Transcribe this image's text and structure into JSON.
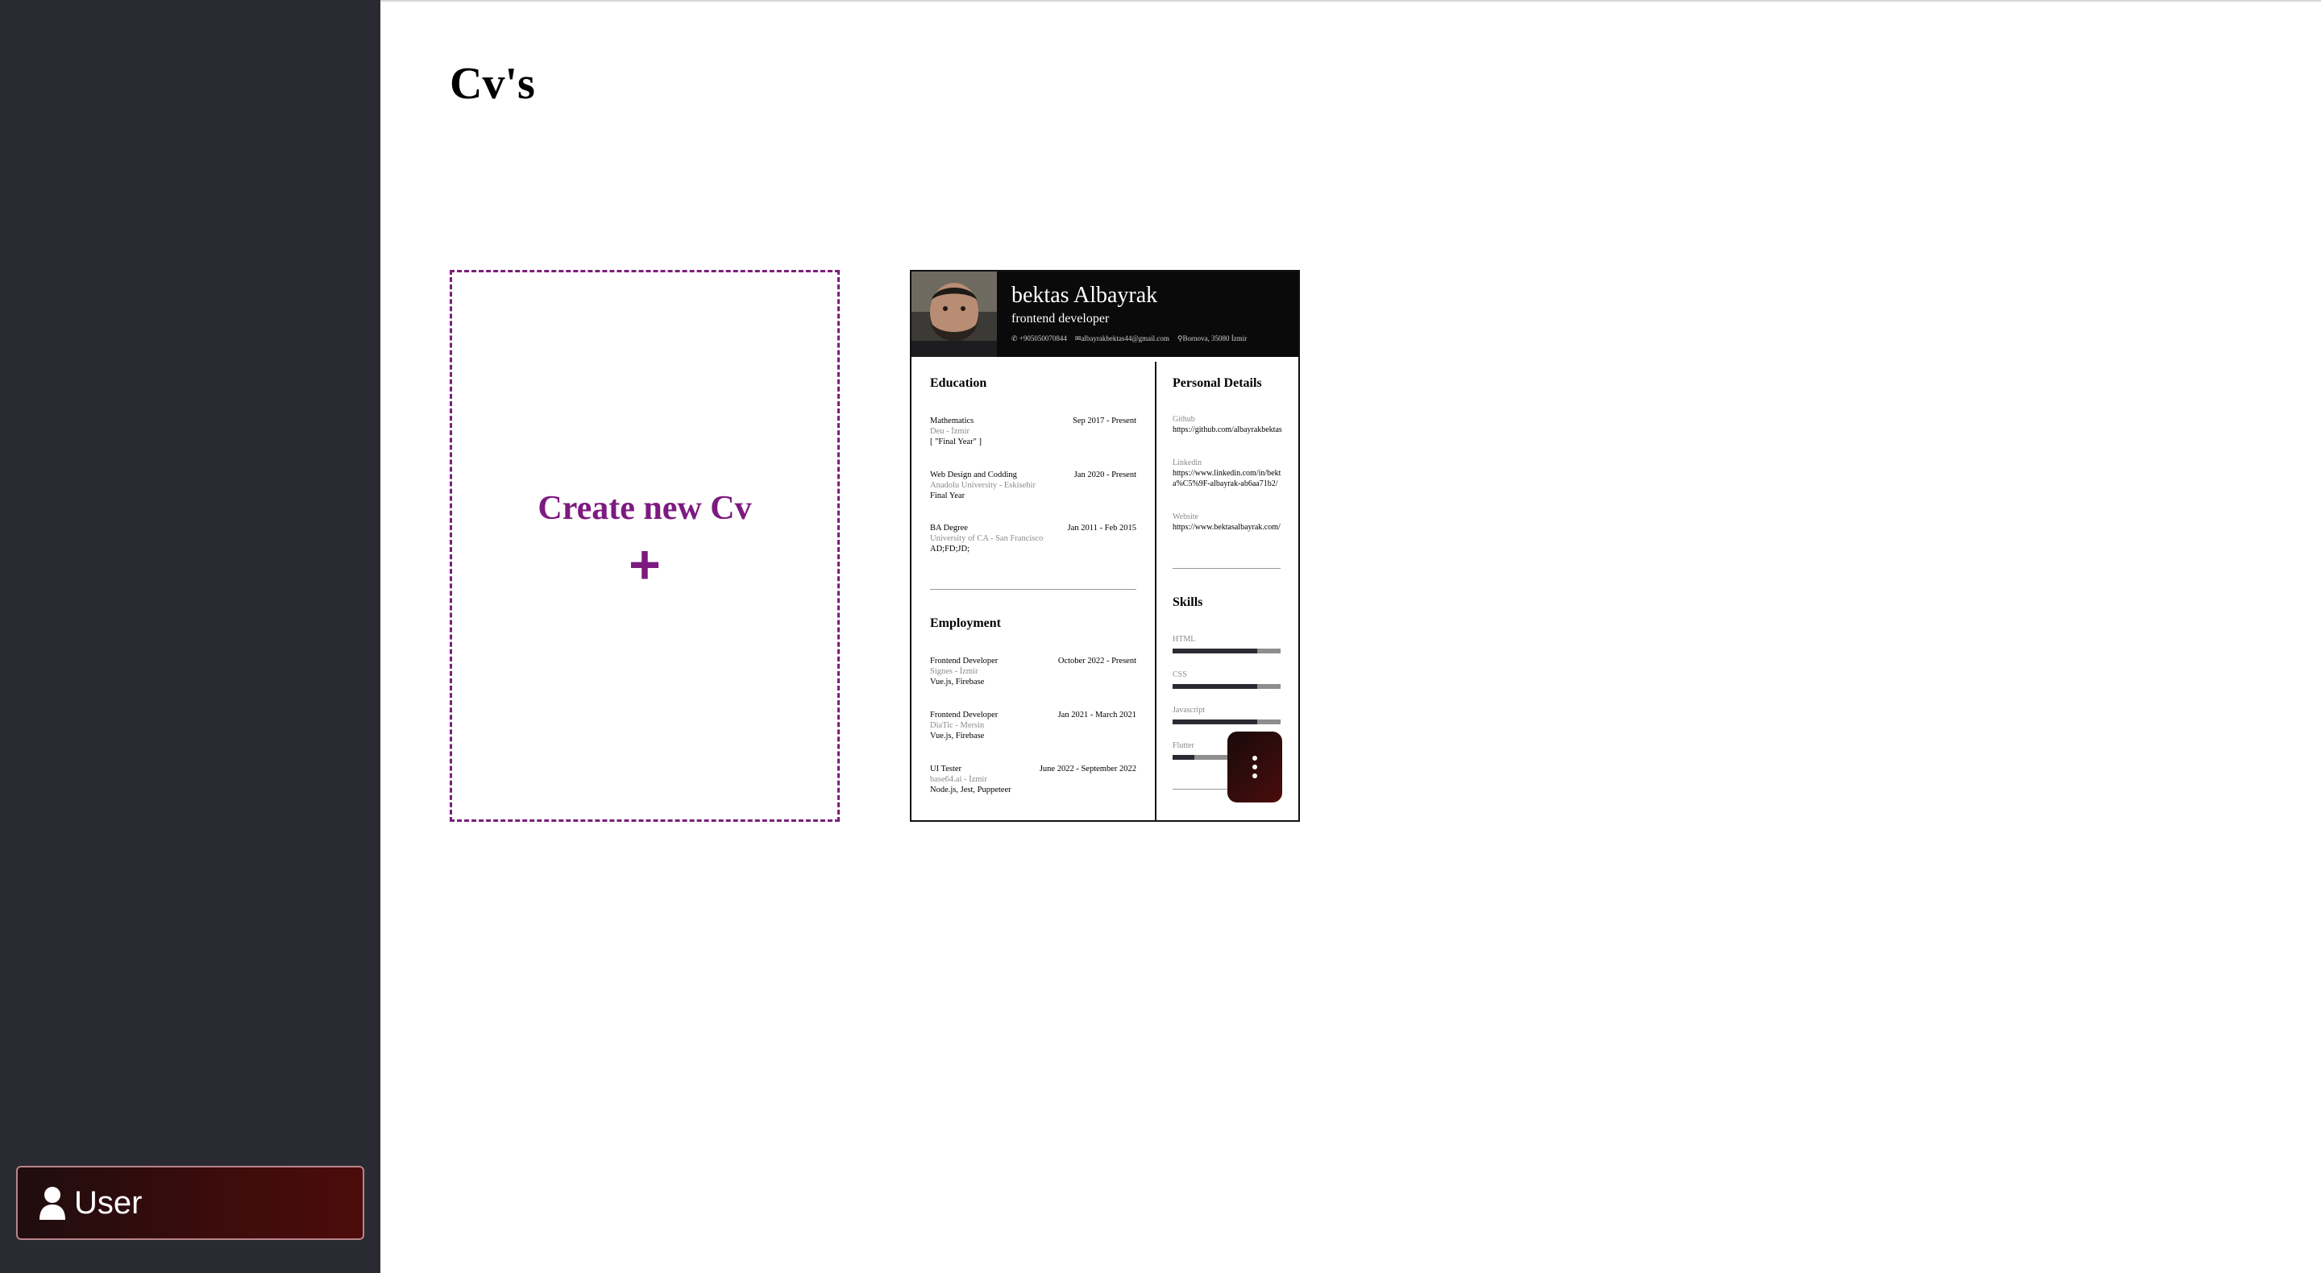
{
  "page": {
    "title": "Cv's"
  },
  "sidebar": {
    "user_label": "User"
  },
  "create_card": {
    "title": "Create new Cv",
    "plus": "+"
  },
  "cv": {
    "name": "bektas Albayrak",
    "role": "frontend developer",
    "contacts": {
      "phone": "+905050070844",
      "email": "albayrakbektas44@gmail.com",
      "location": "Bornova, 35080 İzmir"
    },
    "education": {
      "title": "Education",
      "entries": [
        {
          "degree": "Mathematics",
          "dates": "Sep 2017 - Present",
          "school": "Deu - İzmir",
          "note": "[ \"Final Year\" ]"
        },
        {
          "degree": "Web Design and Codding",
          "dates": "Jan 2020 - Present",
          "school": "Anadolu University - Eskisehir",
          "note": "Final Year"
        },
        {
          "degree": "BA Degree",
          "dates": "Jan 2011 - Feb 2015",
          "school": "University of CA - San Francisco",
          "note": "AD;FD;JD;"
        }
      ]
    },
    "employment": {
      "title": "Employment",
      "entries": [
        {
          "position": "Frontend Developer",
          "dates": "October 2022 - Present",
          "company": "Signes - İzmir",
          "note": "Vue.js, Firebase"
        },
        {
          "position": "Frontend Developer",
          "dates": "Jan 2021 - March 2021",
          "company": "DiaTic - Mersin",
          "note": "Vue.js, Firebase"
        },
        {
          "position": "UI Tester",
          "dates": "June 2022 - September 2022",
          "company": "base64.ai - İzmir",
          "note": "Node.js, Jest, Puppeteer"
        }
      ]
    },
    "personal_details": {
      "title": "Personal Details",
      "items": [
        {
          "label": "Github",
          "value": "https://github.com/albayrakbektas"
        },
        {
          "label": "Linkedin",
          "value": "https://www.linkedin.com/in/bekta%C5%9F-albayrak-ab6aa71b2/"
        },
        {
          "label": "Website",
          "value": "https://www.bektasalbayrak.com/"
        }
      ]
    },
    "skills": {
      "title": "Skills",
      "items": [
        {
          "name": "HTML",
          "level": 0.78
        },
        {
          "name": "CSS",
          "level": 0.78
        },
        {
          "name": "Javascript",
          "level": 0.78
        },
        {
          "name": "Flutter",
          "level": 0.2
        }
      ]
    }
  },
  "colors": {
    "sidebar_bg": "#2a2b32",
    "accent_purple": "#7d1a80",
    "user_button_gradient_end": "#4d0b0b"
  },
  "icons": {
    "user": "user-icon",
    "menu": "more-vertical-icon",
    "plus": "plus-icon"
  }
}
